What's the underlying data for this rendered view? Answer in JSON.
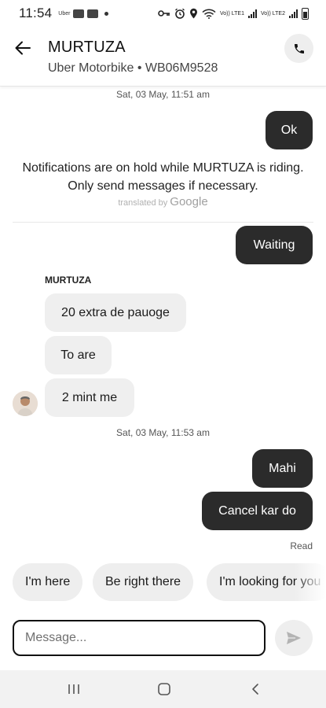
{
  "status_bar": {
    "time": "11:54",
    "app_badges": [
      "Uber"
    ],
    "network_labels": [
      "Vo)) LTE1",
      "Vo)) LTE2"
    ]
  },
  "header": {
    "title": "MURTUZA",
    "subtitle": "Uber Motorbike • WB06M9528",
    "icons": {
      "back": "arrow-left-icon",
      "call": "phone-icon"
    }
  },
  "conversation": {
    "timestamp_1": "Sat, 03 May, 11:51 am",
    "msg_ok": "Ok",
    "notice_line_1": "Notifications are on hold while MURTUZA is riding.",
    "notice_line_2": "Only send messages if necessary.",
    "translated_by": "translated by",
    "google": "Google",
    "msg_waiting": "Waiting",
    "sender_name": "MURTUZA",
    "incoming": [
      "20 extra de pauoge",
      "To are",
      "2 mint me"
    ],
    "timestamp_2": "Sat, 03 May, 11:53 am",
    "msg_mahi": "Mahi",
    "msg_cancel": "Cancel kar do",
    "read_receipt": "Read"
  },
  "quick_replies": [
    "I'm here",
    "Be right there",
    "I'm looking for you"
  ],
  "composer": {
    "placeholder": "Message...",
    "value": "",
    "send_icon": "send-icon"
  },
  "nav_bar": {
    "icons": [
      "recents-icon",
      "home-icon",
      "back-icon"
    ]
  },
  "colors": {
    "outgoing_bubble": "#2b2b2b",
    "incoming_bubble": "#efefef",
    "chip": "#eeeeee",
    "nav_bar": "#f2f2f2"
  }
}
